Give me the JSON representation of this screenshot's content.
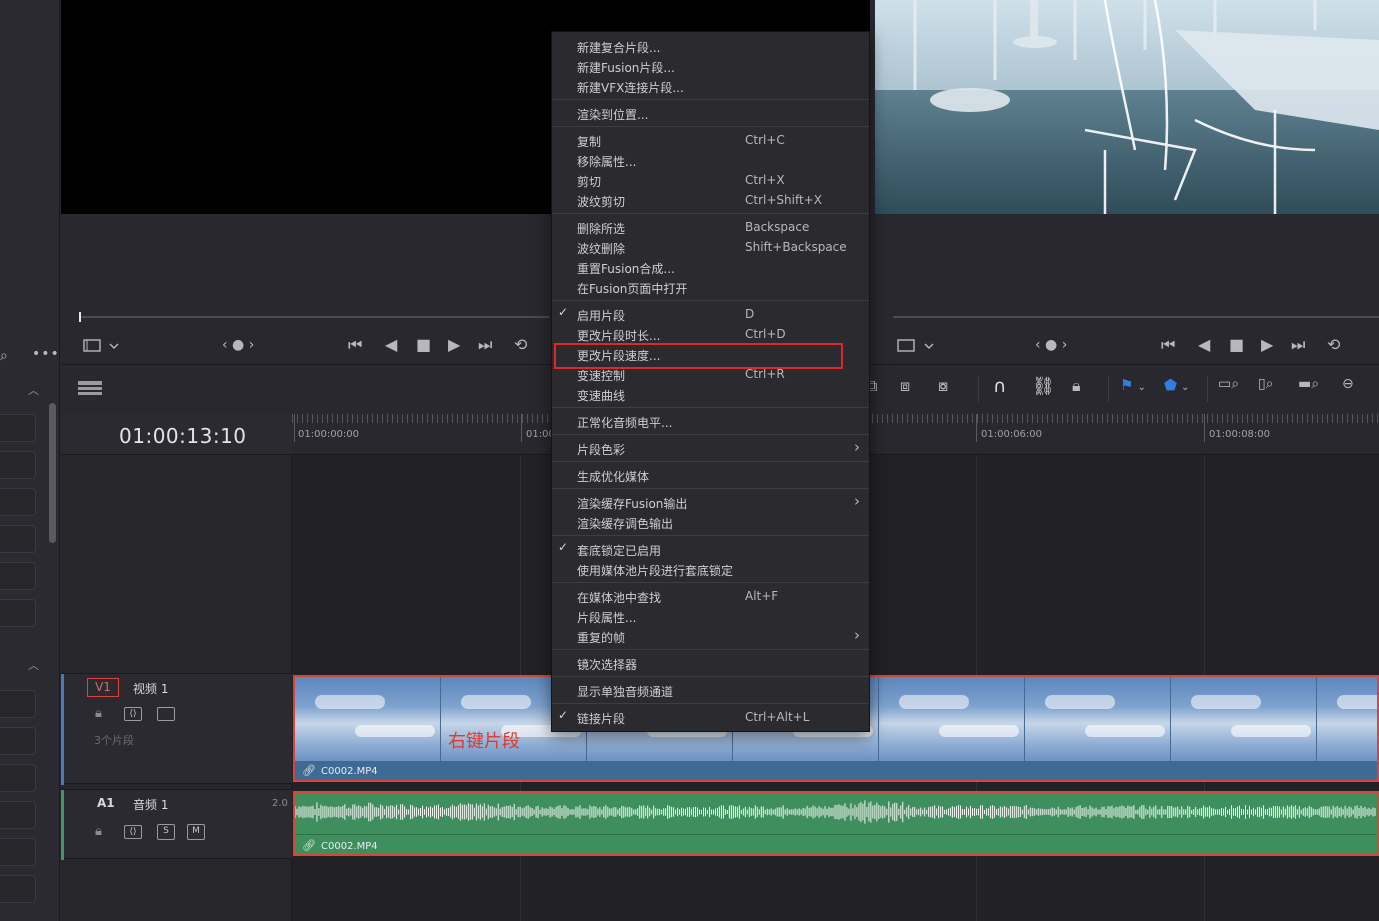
{
  "viewer": {
    "source_nav": "‹ ● ›",
    "timeline_nav": "‹ ● ›"
  },
  "timeline": {
    "timecode": "01:00:13:10",
    "ruler_labels": [
      "01:00:00:00",
      "01:00",
      "01:00:06:00",
      "01:00:08:00"
    ]
  },
  "tracks": {
    "v1": {
      "id": "V1",
      "name": "视频 1",
      "clip_count": "3个片段"
    },
    "a1": {
      "id": "A1",
      "name": "音频 1",
      "level": "2.0",
      "solo": "S",
      "mute": "M"
    }
  },
  "clips": {
    "video_name": "C0002.MP4",
    "audio_name": "C0002.MP4"
  },
  "annotation": {
    "text": "右键片段",
    "color": "#e03a2c"
  },
  "context_menu": {
    "items": [
      {
        "label": "新建复合片段...",
        "shortcut": ""
      },
      {
        "label": "新建Fusion片段...",
        "shortcut": ""
      },
      {
        "label": "新建VFX连接片段...",
        "shortcut": ""
      },
      {
        "label": "渲染到位置...",
        "shortcut": ""
      },
      {
        "label": "复制",
        "shortcut": "Ctrl+C"
      },
      {
        "label": "移除属性...",
        "shortcut": ""
      },
      {
        "label": "剪切",
        "shortcut": "Ctrl+X"
      },
      {
        "label": "波纹剪切",
        "shortcut": "Ctrl+Shift+X"
      },
      {
        "label": "删除所选",
        "shortcut": "Backspace"
      },
      {
        "label": "波纹删除",
        "shortcut": "Shift+Backspace"
      },
      {
        "label": "重置Fusion合成...",
        "shortcut": ""
      },
      {
        "label": "在Fusion页面中打开",
        "shortcut": ""
      },
      {
        "label": "启用片段",
        "shortcut": "D",
        "checked": "✓"
      },
      {
        "label": "更改片段时长...",
        "shortcut": "Ctrl+D"
      },
      {
        "label": "更改片段速度...",
        "shortcut": ""
      },
      {
        "label": "变速控制",
        "shortcut": "Ctrl+R"
      },
      {
        "label": "变速曲线",
        "shortcut": ""
      },
      {
        "label": "正常化音频电平...",
        "shortcut": ""
      },
      {
        "label": "片段色彩",
        "shortcut": "",
        "submenu": "›"
      },
      {
        "label": "生成优化媒体",
        "shortcut": ""
      },
      {
        "label": "渲染缓存Fusion输出",
        "shortcut": "",
        "submenu": "›"
      },
      {
        "label": "渲染缓存调色输出",
        "shortcut": ""
      },
      {
        "label": "套底锁定已启用",
        "shortcut": "",
        "checked": "✓"
      },
      {
        "label": "使用媒体池片段进行套底锁定",
        "shortcut": ""
      },
      {
        "label": "在媒体池中查找",
        "shortcut": "Alt+F"
      },
      {
        "label": "片段属性...",
        "shortcut": ""
      },
      {
        "label": "重复的帧",
        "shortcut": "",
        "submenu": "›"
      },
      {
        "label": "镜次选择器",
        "shortcut": ""
      },
      {
        "label": "显示单独音频通道",
        "shortcut": ""
      },
      {
        "label": "链接片段",
        "shortcut": "Ctrl+Alt+L",
        "checked": "✓"
      }
    ]
  },
  "colors": {
    "highlight_border": "#e0262c",
    "video_track_accent": "#4b79b8",
    "audio_track_accent": "#3d9a66",
    "clip_border": "#d9453a"
  }
}
